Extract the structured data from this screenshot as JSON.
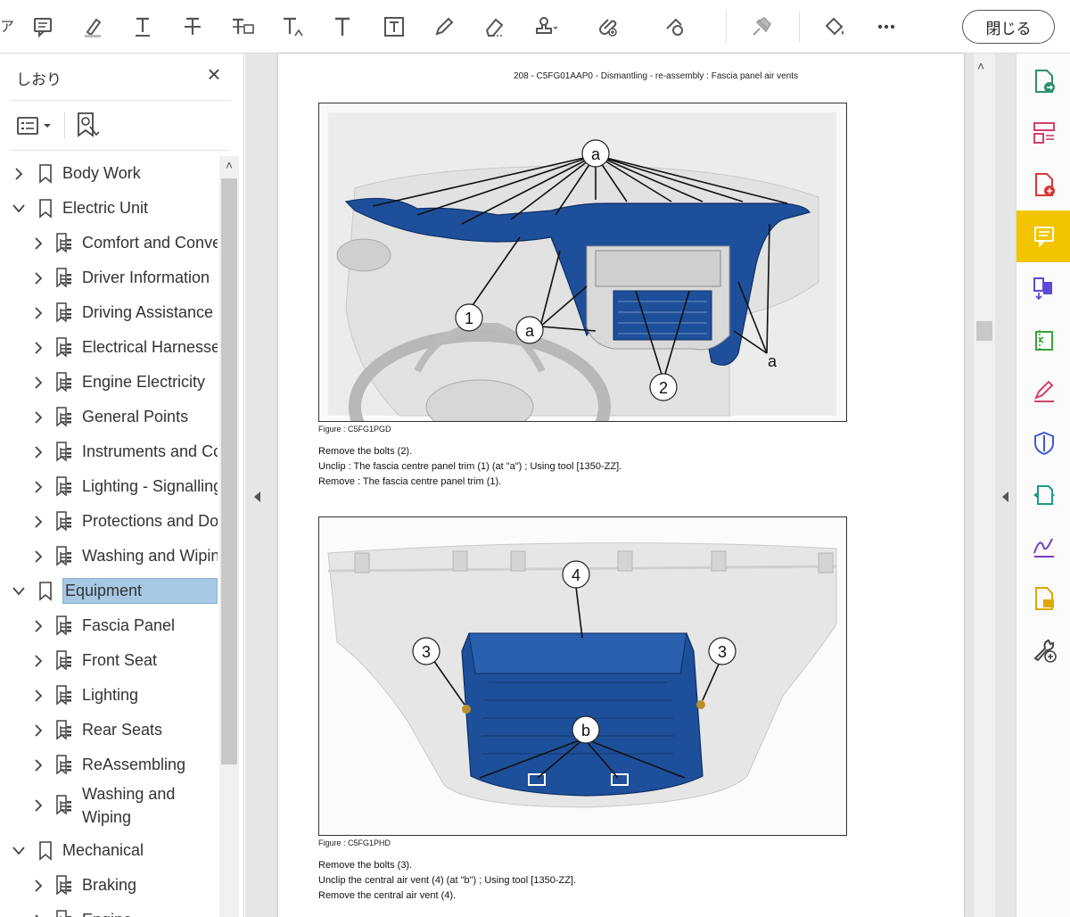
{
  "toolbar": {
    "close_label": "閉じる",
    "tools": [
      "comment-icon",
      "highlight-icon",
      "underline-text-icon",
      "strikethrough-text-icon",
      "replace-text-icon",
      "insert-text-icon",
      "add-text-icon",
      "text-box-icon",
      "pencil-icon",
      "eraser-icon",
      "stamp-icon",
      "attach-file-icon",
      "shapes-icon",
      "pin-icon",
      "fill-sign-icon",
      "more-icon"
    ]
  },
  "bookmarks_panel": {
    "title": "しおり",
    "items": [
      {
        "label": "Body Work",
        "level": 0,
        "expanded": false
      },
      {
        "label": "Electric Unit",
        "level": 0,
        "expanded": true
      },
      {
        "label": "Comfort and Conve",
        "level": 1
      },
      {
        "label": "Driver Information",
        "level": 1
      },
      {
        "label": "Driving Assistance",
        "level": 1
      },
      {
        "label": "Electrical Harnesses",
        "level": 1
      },
      {
        "label": "Engine Electricity",
        "level": 1
      },
      {
        "label": "General Points",
        "level": 1
      },
      {
        "label": "Instruments and Cc",
        "level": 1
      },
      {
        "label": "Lighting - Signalling",
        "level": 1
      },
      {
        "label": "Protections and Do",
        "level": 1
      },
      {
        "label": "Washing and Wipin",
        "level": 1
      },
      {
        "label": "Equipment",
        "level": 0,
        "expanded": true,
        "selected": true
      },
      {
        "label": "Fascia Panel",
        "level": 1
      },
      {
        "label": "Front Seat",
        "level": 1
      },
      {
        "label": "Lighting",
        "level": 1
      },
      {
        "label": "Rear Seats",
        "level": 1
      },
      {
        "label": "ReAssembling",
        "level": 1
      },
      {
        "label": "Washing and Wiping",
        "level": 1
      },
      {
        "label": "Mechanical",
        "level": 0,
        "expanded": true
      },
      {
        "label": "Braking",
        "level": 1
      },
      {
        "label": "Engine",
        "level": 1
      }
    ]
  },
  "document": {
    "header": "208 - C5FG01AAP0 - Dismantling - re-assembly : Fascia panel air vents",
    "figure1": {
      "caption": "Figure : C5FG1PGD",
      "callouts": [
        "a",
        "1",
        "a",
        "2",
        "a"
      ]
    },
    "instructions1": [
      "Remove the bolts (2).",
      "Unclip : The fascia centre panel trim (1) (at \"a\") ; Using tool [1350-ZZ].",
      "Remove : The fascia centre panel trim (1)."
    ],
    "figure2": {
      "caption": "Figure : C5FG1PHD",
      "callouts": [
        "4",
        "3",
        "3",
        "b"
      ]
    },
    "instructions2": [
      "Remove the bolts (3).",
      "Unclip the central air vent (4) (at \"b\") ; Using tool [1350-ZZ].",
      "Remove the central air vent (4)."
    ]
  },
  "right_rail": [
    "export-pdf-icon",
    "organize-pages-icon",
    "create-pdf-icon",
    "comment-icon",
    "combine-files-icon",
    "compress-icon",
    "fill-sign-icon",
    "protect-icon",
    "send-for-review-icon",
    "request-signature-icon",
    "edit-pdf-icon",
    "more-tools-icon"
  ],
  "colors": {
    "accent": "#f3c400",
    "selected": "#a6c8e4",
    "part_blue": "#1e4f9a"
  }
}
